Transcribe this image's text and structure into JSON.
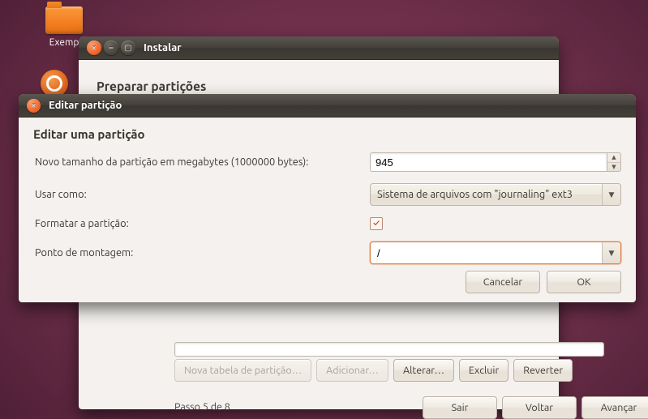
{
  "desktop": {
    "folder_label": "Exemp"
  },
  "installer": {
    "window_title": "Instalar",
    "heading": "Preparar partições",
    "buttons": {
      "new_table": "Nova tabela de partição…",
      "add": "Adicionar…",
      "change": "Alterar…",
      "delete": "Excluir",
      "revert": "Reverter",
      "quit": "Sair",
      "back": "Voltar",
      "forward": "Avançar"
    },
    "step_text": "Passo 5 de 8"
  },
  "edit_dialog": {
    "window_title": "Editar partição",
    "heading": "Editar uma partição",
    "labels": {
      "size": "Novo tamanho da partição em megabytes (1000000 bytes):",
      "use_as": "Usar como:",
      "format": "Formatar a partição:",
      "mount": "Ponto de montagem:"
    },
    "values": {
      "size": "945",
      "use_as": "Sistema de arquivos com \"journaling\" ext3",
      "format_checked": "✓",
      "mount": "/"
    },
    "buttons": {
      "cancel": "Cancelar",
      "ok": "OK"
    }
  }
}
